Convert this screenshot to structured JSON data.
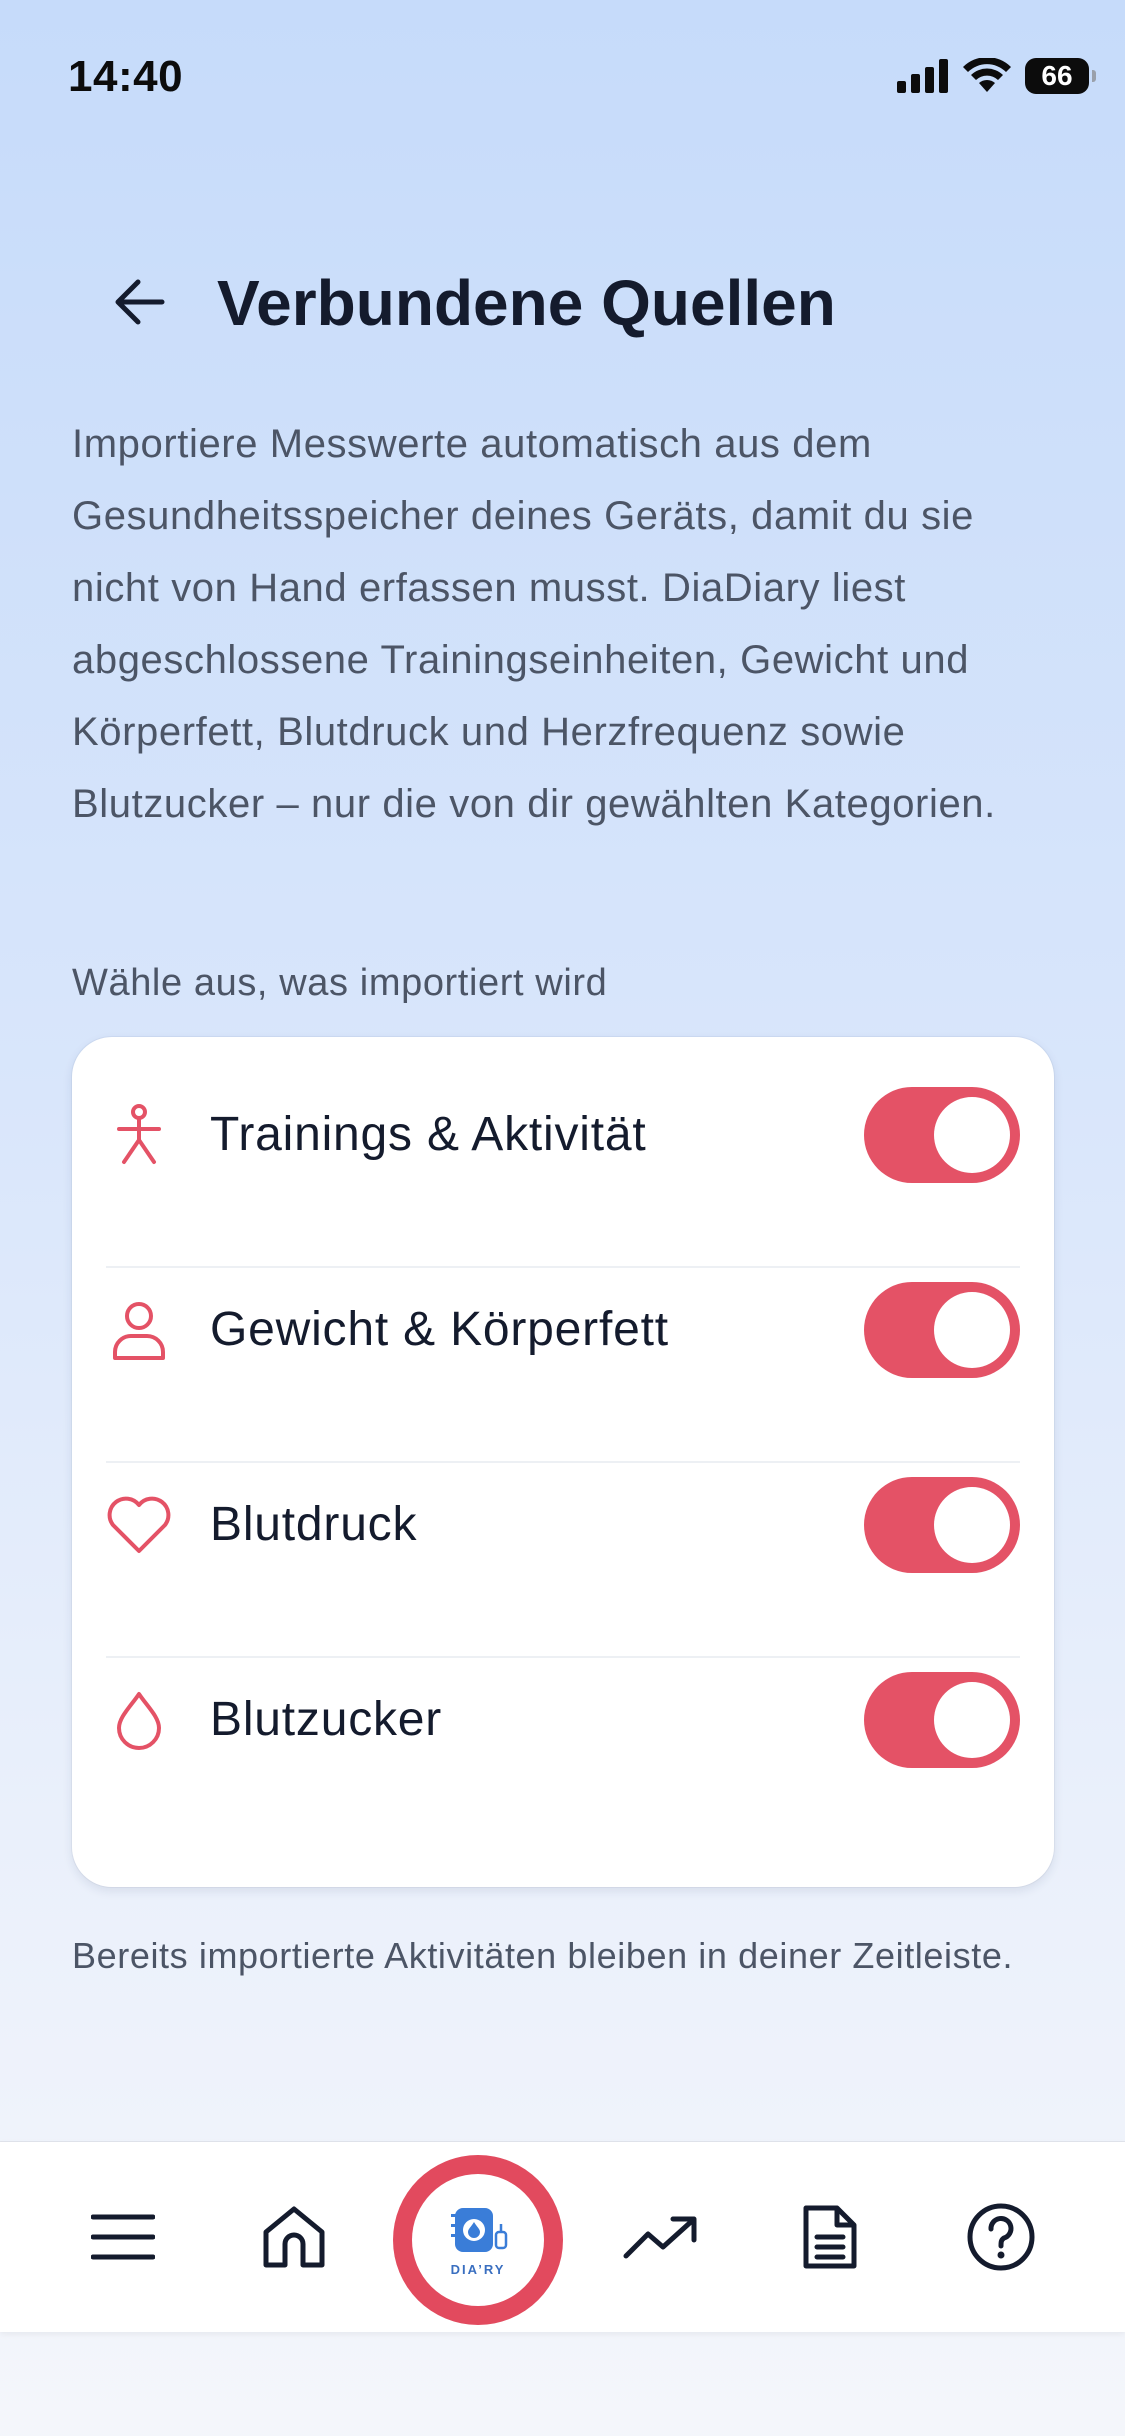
{
  "status_bar": {
    "time": "14:40",
    "battery": "66"
  },
  "header": {
    "title": "Verbundene Quellen"
  },
  "intro_text": "Importiere Messwerte automatisch aus dem Gesundheitsspeicher deines Geräts, damit du sie nicht von Hand erfassen musst. DiaDiary liest abgeschlossene Trainingseinheiten, Gewicht und Körperfett, Blutdruck und Herzfrequenz sowie Blutzucker – nur die von dir gewählten Kategorien.",
  "section_label": "Wähle aus, was importiert wird",
  "categories": [
    {
      "label": "Trainings & Aktivität",
      "icon": "person-walking-icon",
      "enabled": true
    },
    {
      "label": "Gewicht & Körperfett",
      "icon": "user-icon",
      "enabled": true
    },
    {
      "label": "Blutdruck",
      "icon": "heart-icon",
      "enabled": true
    },
    {
      "label": "Blutzucker",
      "icon": "drop-icon",
      "enabled": true
    }
  ],
  "footnote": "Bereits importierte Aktivitäten bleiben in deiner Zeitleiste.",
  "tabbar": {
    "items": [
      "menu-icon",
      "home-icon",
      "diary-logo",
      "trend-icon",
      "document-icon",
      "help-icon"
    ],
    "logo_text": "DIA’RY"
  },
  "colors": {
    "accent": "#e45266",
    "text": "#141b2d",
    "muted": "#4c5566"
  }
}
